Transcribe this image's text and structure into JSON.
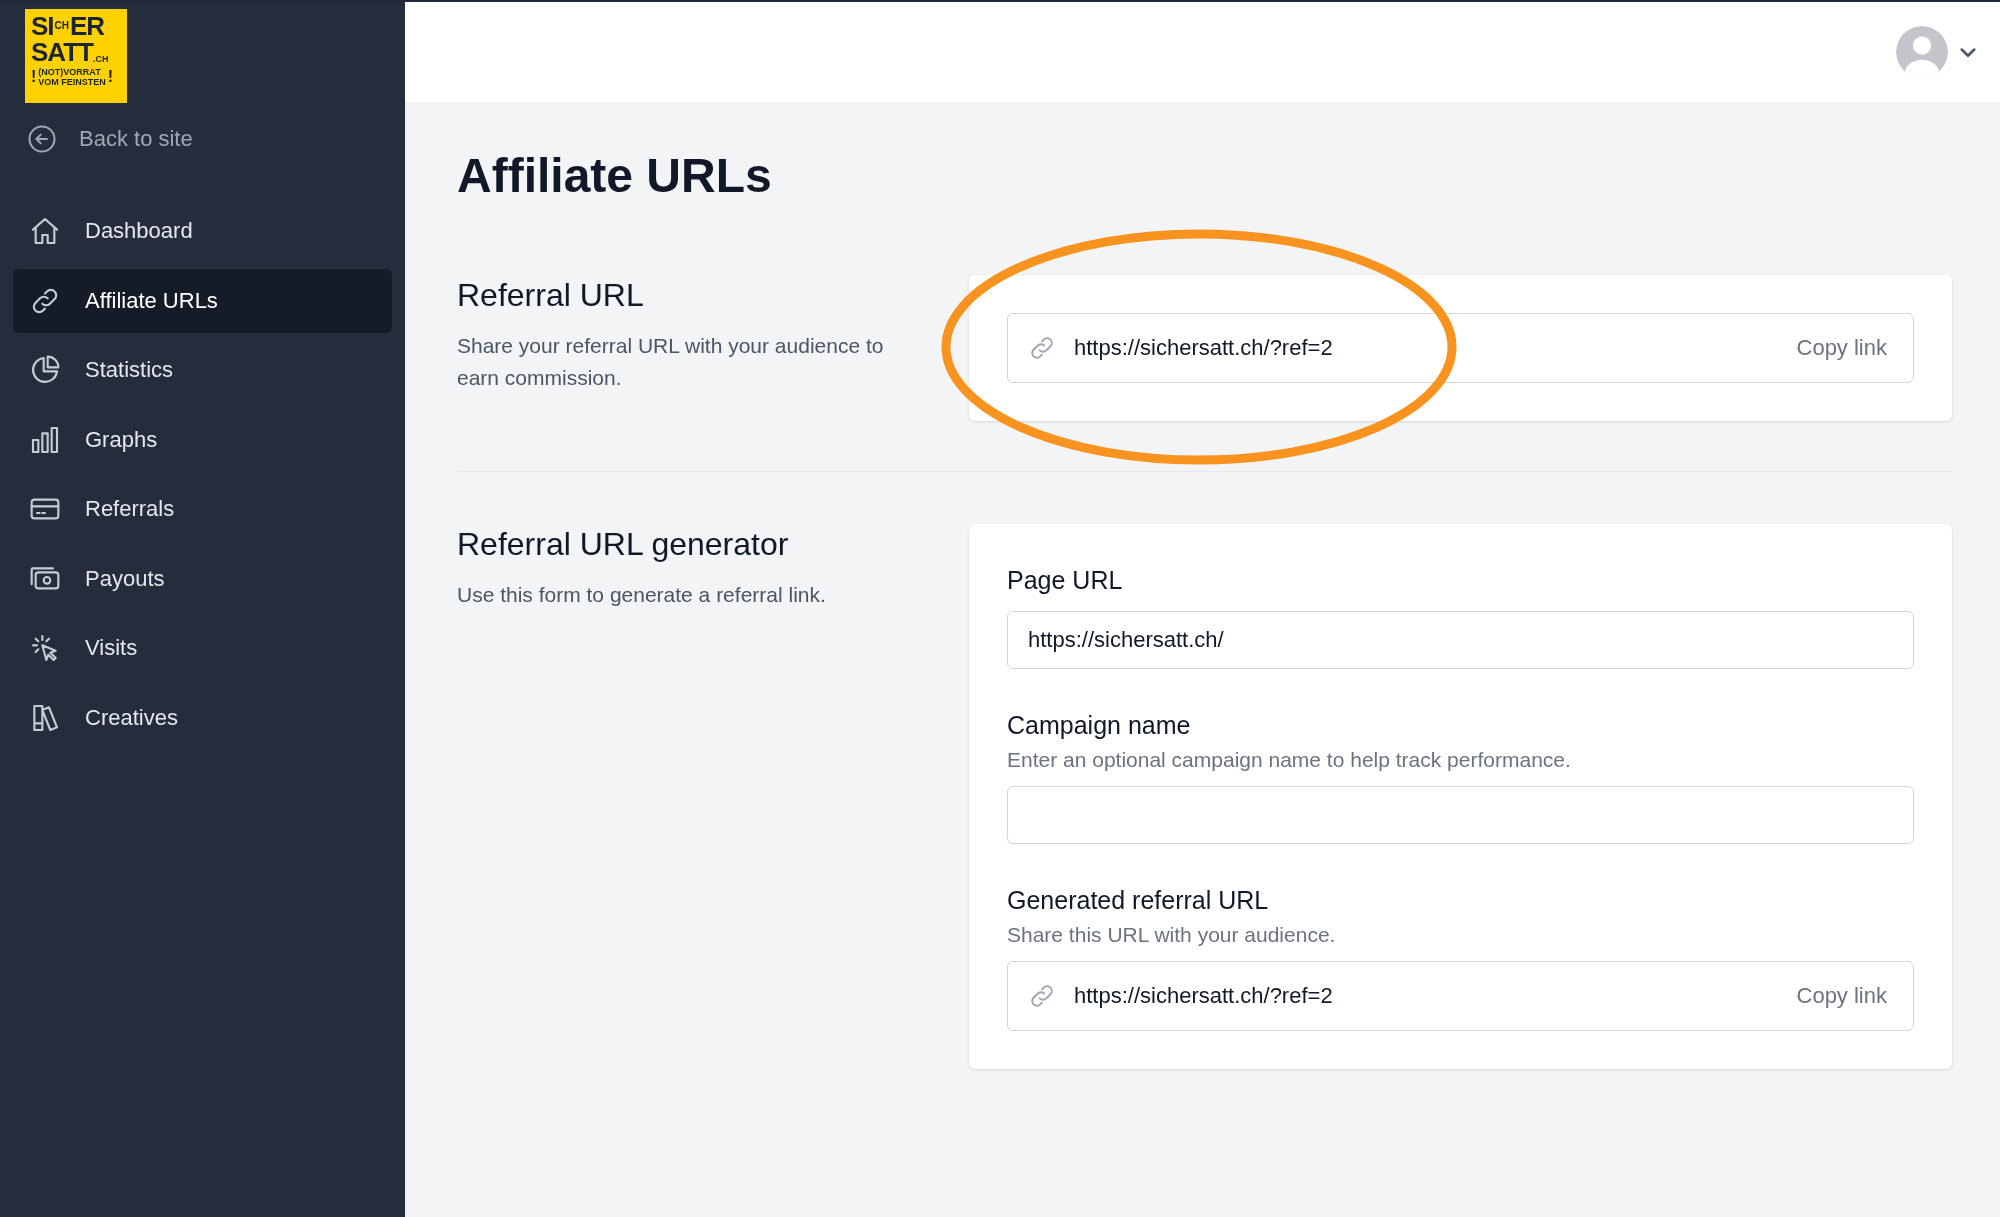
{
  "logo": {
    "top_left": "SI",
    "top_rotated": "CH",
    "top_right": "ER",
    "middle": "SATT",
    "domain": ".CH",
    "tagline_1": "(NOT)VORRAT",
    "tagline_2": "VOM FEINSTEN",
    "mark_left": "!",
    "mark_right": "!"
  },
  "back_link": "Back to site",
  "nav": [
    {
      "label": "Dashboard",
      "kind": "home",
      "selected": false
    },
    {
      "label": "Affiliate URLs",
      "kind": "link",
      "selected": true
    },
    {
      "label": "Statistics",
      "kind": "pie",
      "selected": false
    },
    {
      "label": "Graphs",
      "kind": "bars",
      "selected": false
    },
    {
      "label": "Referrals",
      "kind": "card",
      "selected": false
    },
    {
      "label": "Payouts",
      "kind": "cash",
      "selected": false
    },
    {
      "label": "Visits",
      "kind": "cursor",
      "selected": false
    },
    {
      "label": "Creatives",
      "kind": "book",
      "selected": false
    }
  ],
  "page_title": "Affiliate URLs",
  "referral": {
    "heading": "Referral URL",
    "description": "Share your referral URL with your audience to earn commission.",
    "url": "https://sichersatt.ch/?ref=2",
    "copy": "Copy link"
  },
  "generator": {
    "heading": "Referral URL generator",
    "description": "Use this form to generate a referral link.",
    "fields": [
      {
        "kind": "input",
        "label": "Page URL",
        "value": "https://sichersatt.ch/"
      },
      {
        "kind": "input",
        "label": "Campaign name",
        "help": "Enter an optional campaign name to help track performance."
      },
      {
        "kind": "copy",
        "label": "Generated referral URL",
        "help": "Share this URL with your audience.",
        "value": "https://sichersatt.ch/?ref=2",
        "copy": "Copy link"
      }
    ]
  }
}
